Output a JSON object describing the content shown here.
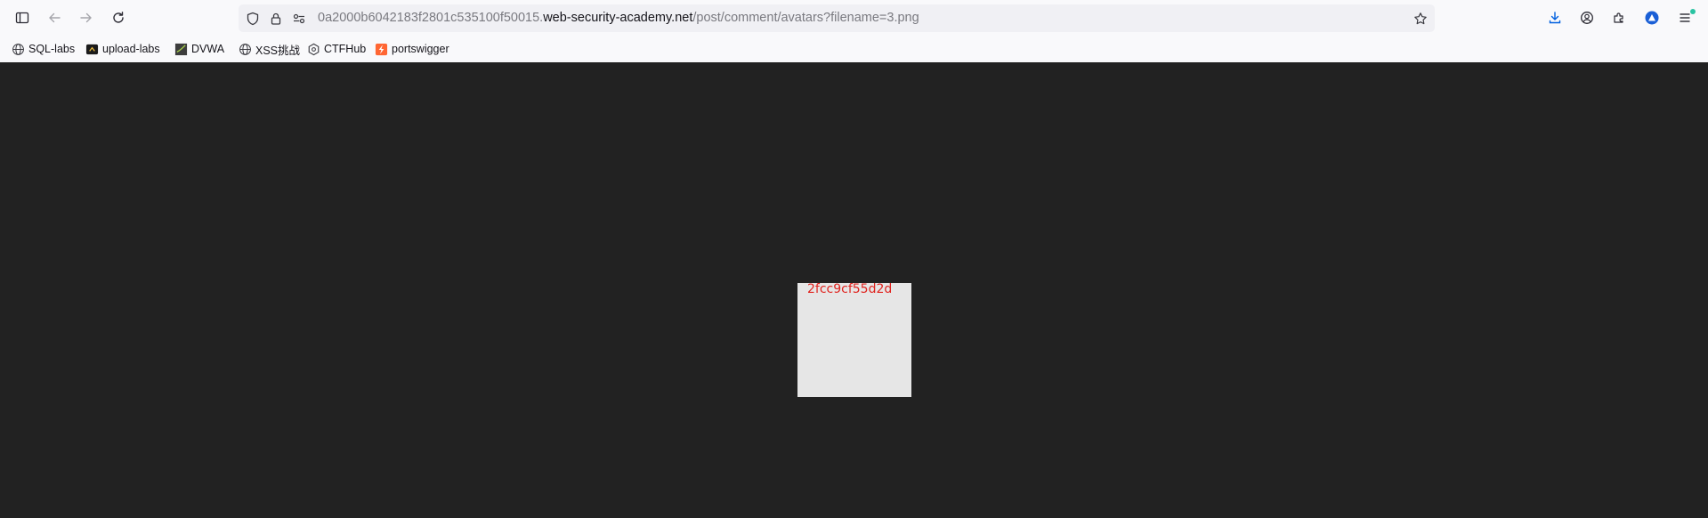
{
  "toolbar": {
    "sidebar_icon": "sidebar-icon",
    "back_icon": "back-arrow-icon",
    "forward_icon": "forward-arrow-icon",
    "reload_icon": "reload-icon"
  },
  "urlbar": {
    "url_prefix": "0a2000b6042183f2801c535100f50015.",
    "url_domain": "web-security-academy.net",
    "url_path": "/post/comment/avatars?filename=3.png",
    "icons": [
      "shield-icon",
      "lock-icon",
      "permissions-icon",
      "bookmark-star-icon"
    ]
  },
  "toolbar_right_icons": [
    "download-icon",
    "account-icon",
    "extensions-icon",
    "vpn-icon",
    "menu-icon"
  ],
  "bookmarks": [
    {
      "label": "SQL-labs",
      "icon": "globe-icon"
    },
    {
      "label": "upload-labs",
      "icon": "upload-labs-icon"
    },
    {
      "label": "DVWA",
      "icon": "dvwa-icon"
    },
    {
      "label": "XSS挑战",
      "icon": "globe-icon"
    },
    {
      "label": "CTFHub",
      "icon": "ctfhub-icon"
    },
    {
      "label": "portswigger",
      "icon": "portswigger-icon"
    }
  ],
  "content": {
    "avatar_text": "2fcc9cf55d2d",
    "background_color": "#222222",
    "image_color": "#e6e6e6",
    "text_color": "#e0231e"
  }
}
